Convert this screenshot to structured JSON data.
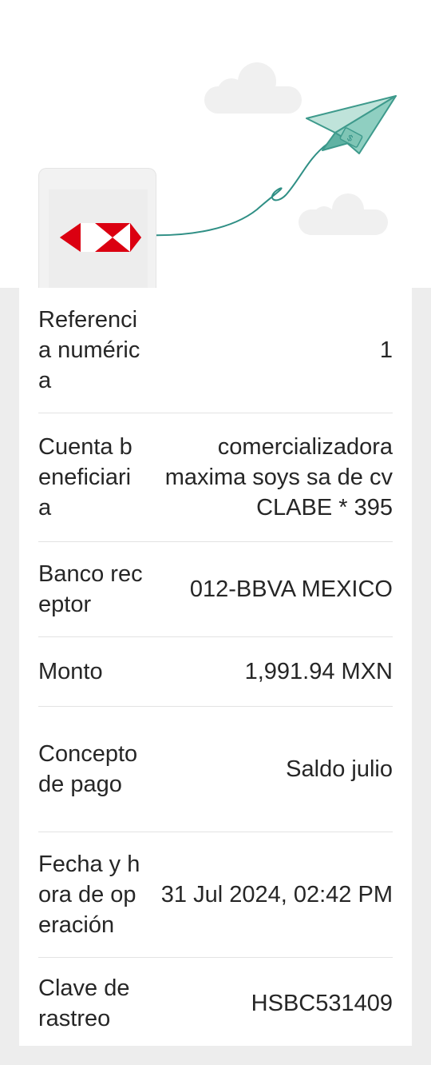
{
  "header": {
    "logo_icon": "hsbc-hexagon-logo",
    "illustration_icon": "paper-airplane-icon",
    "colors": {
      "brand_red": "#db0011",
      "airplane_teal": "#7fc5b5",
      "line_teal": "#2f8f85"
    }
  },
  "details": [
    {
      "label": "Referencia numérica",
      "value": "1"
    },
    {
      "label": "Cuenta beneficiaria",
      "value": "comercializadora maxima soys sa de cv CLABE * 395"
    },
    {
      "label": "Banco receptor",
      "value": "012-BBVA MEXICO"
    },
    {
      "label": "Monto",
      "value": "1,991.94 MXN"
    },
    {
      "label": "Concepto de pago",
      "value": "Saldo julio"
    },
    {
      "label": "Fecha y hora de operación",
      "value": "31 Jul 2024, 02:42 PM"
    },
    {
      "label": "Clave de rastreo",
      "value": "HSBC531409"
    }
  ]
}
